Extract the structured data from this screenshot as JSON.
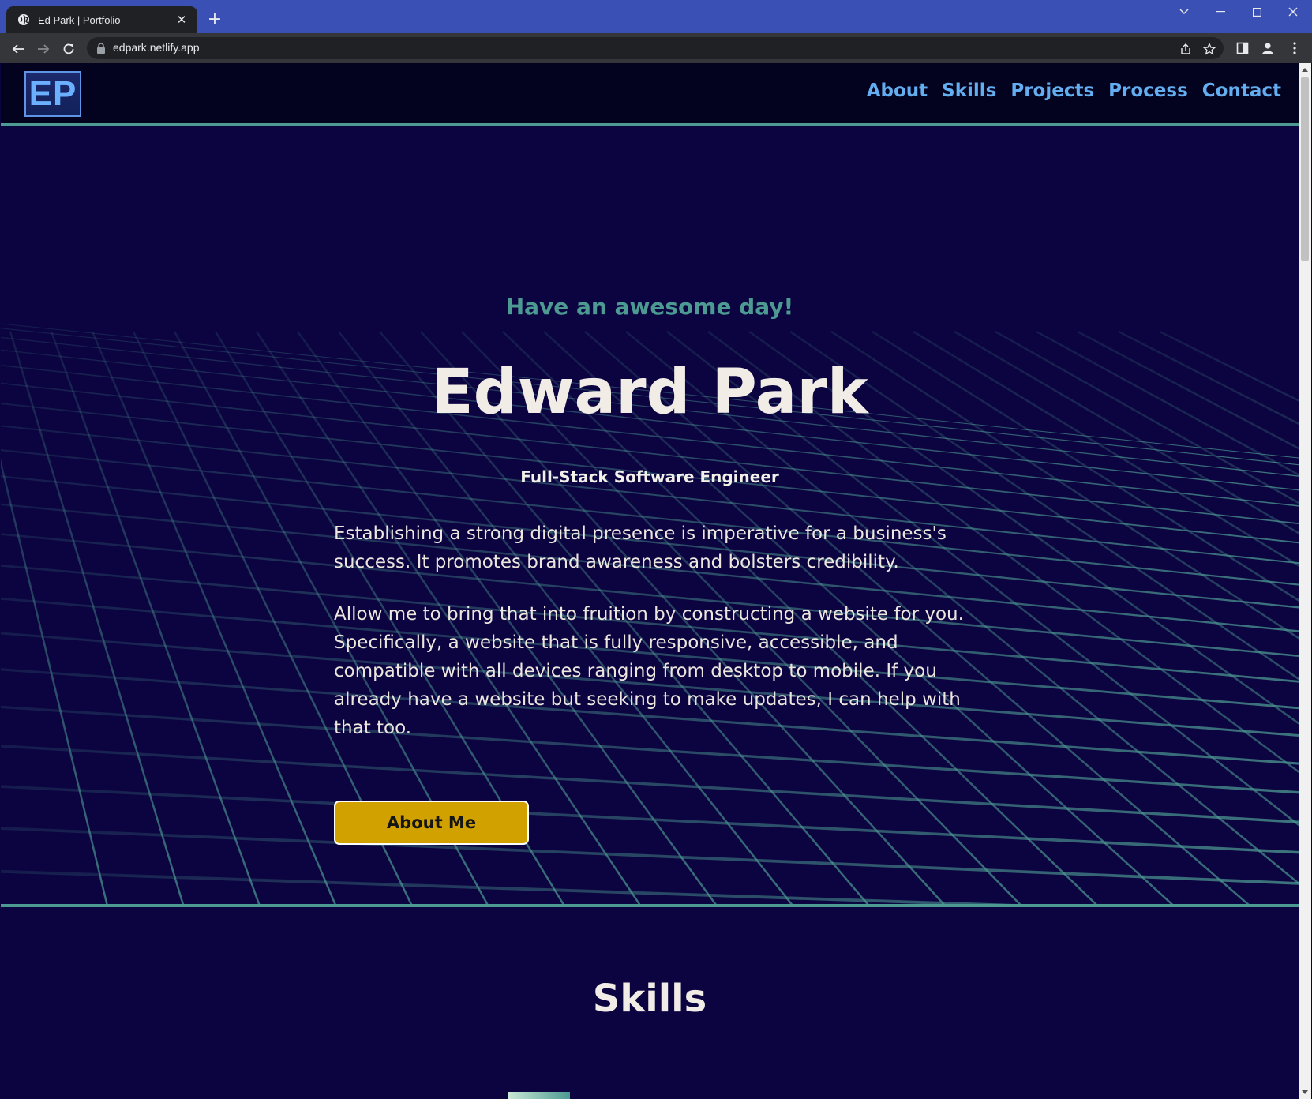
{
  "browser": {
    "tab_title": "Ed Park | Portfolio",
    "tab_close": "✕",
    "new_tab": "+",
    "url": "edpark.netlify.app"
  },
  "site": {
    "logo": "EP",
    "nav": [
      "About",
      "Skills",
      "Projects",
      "Process",
      "Contact"
    ]
  },
  "hero": {
    "greeting": "Have an awesome day!",
    "name": "Edward Park",
    "role": "Full-Stack Software Engineer",
    "paragraph1": "Establishing a strong digital presence is imperative for a business's success. It promotes brand awareness and bolsters credibility.",
    "paragraph2": "Allow me to bring that into fruition by constructing a website for you. Specifically, a website that is fully responsive, accessible, and compatible with all devices ranging from desktop to mobile. If you already have a website but seeking to make updates, I can help with that too.",
    "cta_label": "About Me"
  },
  "skills": {
    "title": "Skills"
  },
  "colors": {
    "chrome_titlebar": "#3a50b4",
    "page_bg": "#0b0440",
    "header_bg": "#03031f",
    "accent_teal": "#4d9a92",
    "nav_link": "#63aef0",
    "cta_bg": "#d1a100"
  },
  "icons": [
    "globe-icon",
    "close-icon",
    "plus-icon",
    "chevron-down-icon",
    "minimize-icon",
    "maximize-icon",
    "window-close-icon",
    "back-arrow-icon",
    "forward-arrow-icon",
    "reload-icon",
    "lock-icon",
    "share-icon",
    "star-icon",
    "side-panel-icon",
    "profile-icon",
    "kebab-menu-icon"
  ]
}
